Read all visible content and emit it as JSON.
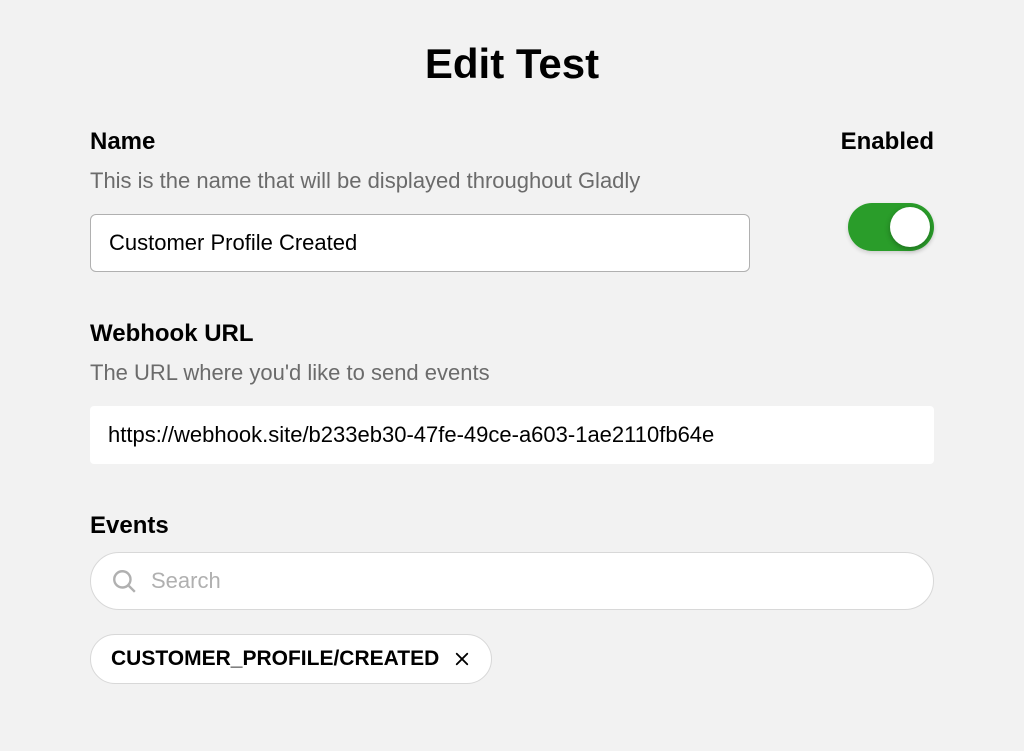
{
  "page": {
    "title": "Edit Test"
  },
  "name": {
    "label": "Name",
    "help": "This is the name that will be displayed throughout Gladly",
    "value": "Customer Profile Created"
  },
  "enabled": {
    "label": "Enabled",
    "value": true
  },
  "webhook": {
    "label": "Webhook URL",
    "help": "The URL where you'd like to send events",
    "value": "https://webhook.site/b233eb30-47fe-49ce-a603-1ae2110fb64e"
  },
  "events": {
    "label": "Events",
    "search_placeholder": "Search",
    "selected": [
      {
        "label": "CUSTOMER_PROFILE/CREATED"
      }
    ]
  }
}
